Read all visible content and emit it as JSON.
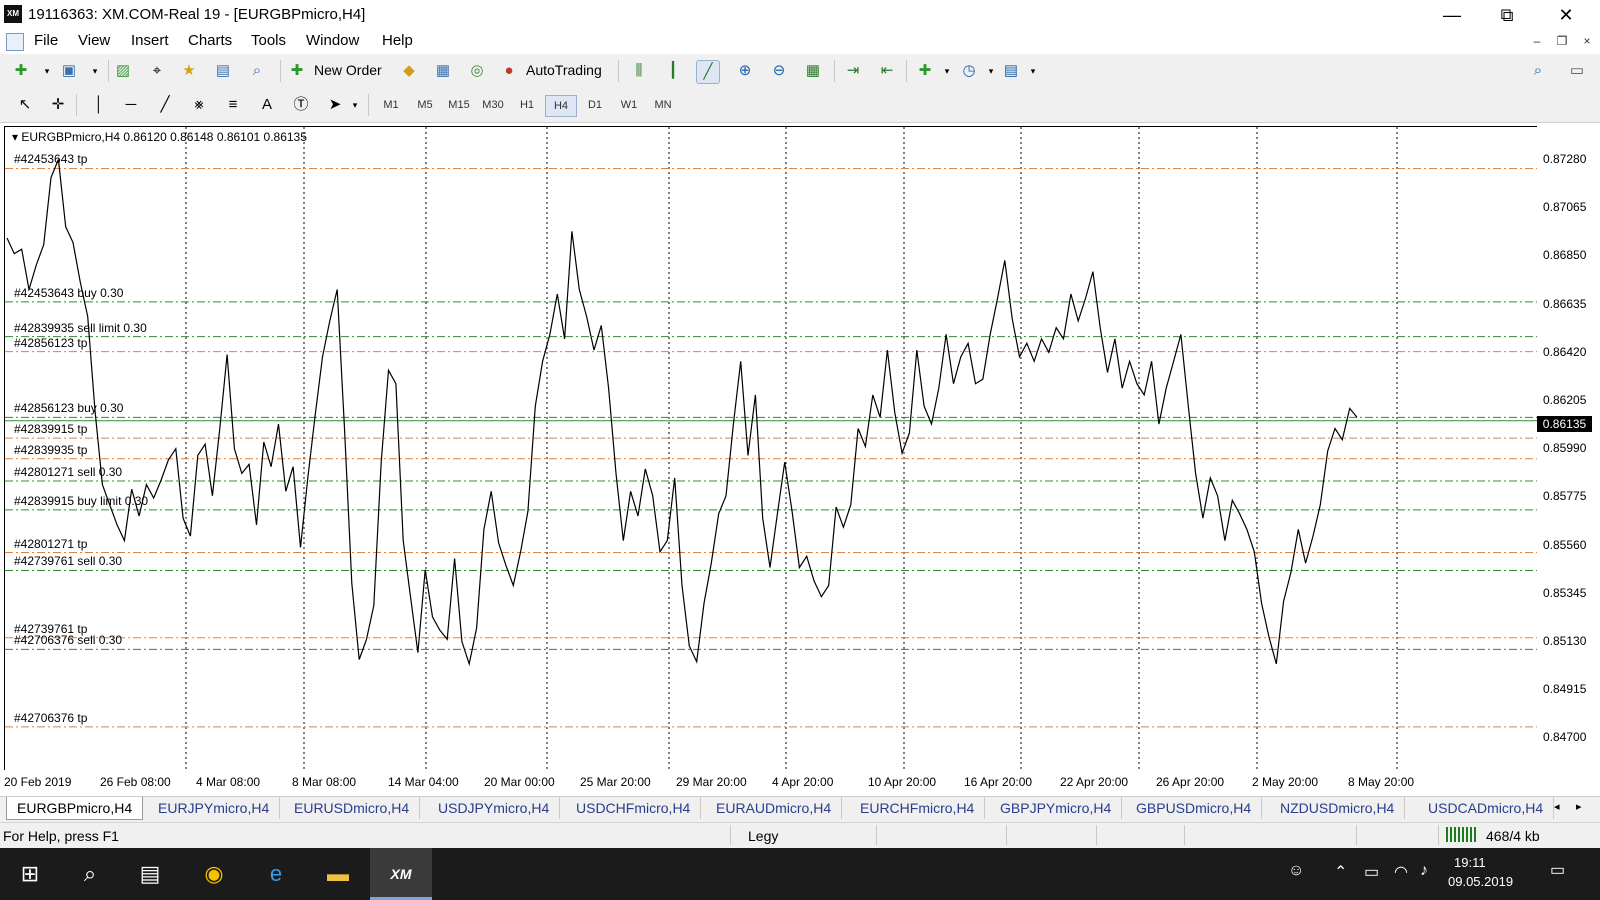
{
  "window": {
    "title": "19116363: XM.COM-Real 19 - [EURGBPmicro,H4]",
    "logo_text": "XM",
    "minimize_symbol": "—",
    "maximize_symbol": "⧉",
    "close_symbol": "✕"
  },
  "menu": {
    "items": [
      "File",
      "View",
      "Insert",
      "Charts",
      "Tools",
      "Window",
      "Help"
    ],
    "mdi_minimize": "–",
    "mdi_restore": "❐",
    "mdi_close": "×"
  },
  "toolbar": {
    "new_order_label": "New Order",
    "autotrading_label": "AutoTrading",
    "timeframes": [
      "M1",
      "M5",
      "M15",
      "M30",
      "H1",
      "H4",
      "D1",
      "W1",
      "MN"
    ],
    "active_timeframe": "H4",
    "icons": [
      "new-chart-icon",
      "profiles-icon",
      "market-watch-icon",
      "navigator-icon",
      "data-window-icon",
      "terminal-icon",
      "strategy-tester-icon",
      "meta-editor-icon",
      "new-order-icon",
      "autotrading-icon",
      "bar-chart-icon",
      "candlesticks-icon",
      "line-chart-icon",
      "zoom-in-icon",
      "zoom-out-icon",
      "tile-windows-icon",
      "auto-scroll-icon",
      "chart-shift-icon",
      "indicators-icon",
      "periods-icon",
      "templates-icon",
      "search-icon",
      "chat-icon",
      "cursor-icon",
      "crosshair-icon",
      "vertical-line-icon",
      "horizontal-line-icon",
      "trendline-icon",
      "equidistant-channel-icon",
      "fibonacci-icon",
      "text-icon",
      "text-label-icon",
      "arrows-icon"
    ]
  },
  "chart": {
    "symbol_info": "EURGBPmicro,H4  0.86120 0.86148 0.86101 0.86135",
    "current_price": "0.86135",
    "price_labels": [
      "0.87280",
      "0.87065",
      "0.86850",
      "0.86635",
      "0.86420",
      "0.86205",
      "0.85990",
      "0.85775",
      "0.85560",
      "0.85345",
      "0.85130",
      "0.84915",
      "0.84700"
    ],
    "time_labels": [
      "20 Feb 2019",
      "26 Feb 08:00",
      "4 Mar 08:00",
      "8 Mar 08:00",
      "14 Mar 04:00",
      "20 Mar 00:00",
      "25 Mar 20:00",
      "29 Mar 20:00",
      "4 Apr 20:00",
      "10 Apr 20:00",
      "16 Apr 20:00",
      "22 Apr 20:00",
      "26 Apr 20:00",
      "2 May 20:00",
      "8 May 20:00"
    ],
    "order_lines": [
      {
        "label": "#42453643 tp",
        "price": 0.8726,
        "color": "#e0803a"
      },
      {
        "label": "#42453643 buy 0.30",
        "price": 0.86665,
        "color": "#2e8b2e"
      },
      {
        "label": "#42839935 sell limit 0.30",
        "price": 0.8651,
        "color": "#2e8b2e"
      },
      {
        "label": "#42856123 tp",
        "price": 0.86443,
        "color": "#e0803a"
      },
      {
        "label": "#42856123 buy 0.30",
        "price": 0.8615,
        "color": "#2e8b2e"
      },
      {
        "label": "#42839915 tp",
        "price": 0.86057,
        "color": "#e0803a"
      },
      {
        "label": "#42839935 tp",
        "price": 0.85965,
        "color": "#e0803a"
      },
      {
        "label": "#42801271 sell 0.30",
        "price": 0.85866,
        "color": "#2e8b2e"
      },
      {
        "label": "#42839915 buy limit 0.30",
        "price": 0.85737,
        "color": "#2e8b2e"
      },
      {
        "label": "#42801271 tp",
        "price": 0.85547,
        "color": "#e0803a"
      },
      {
        "label": "#42739761 sell 0.30",
        "price": 0.85467,
        "color": "#2e8b2e"
      },
      {
        "label": "#42739761 tp",
        "price": 0.85167,
        "color": "#e0803a"
      },
      {
        "label": "#42706376 sell 0.30",
        "price": 0.85115,
        "color": "#2e8b2e"
      },
      {
        "label": "#42706376 tp",
        "price": 0.84769,
        "color": "#e0803a"
      }
    ]
  },
  "chart_data": {
    "type": "line",
    "title": "EURGBPmicro,H4  0.86120 0.86148 0.86101 0.86135",
    "xlabel": "",
    "ylabel": "",
    "ylim": [
      0.8465,
      0.8742
    ],
    "grid": true,
    "x_tick_labels": [
      "20 Feb 2019",
      "26 Feb 08:00",
      "4 Mar 08:00",
      "8 Mar 08:00",
      "14 Mar 04:00",
      "20 Mar 00:00",
      "25 Mar 20:00",
      "29 Mar 20:00",
      "4 Apr 20:00",
      "10 Apr 20:00",
      "16 Apr 20:00",
      "22 Apr 20:00",
      "26 Apr 20:00",
      "2 May 20:00",
      "8 May 20:00"
    ],
    "y_tick_labels": [
      "0.87280",
      "0.87065",
      "0.86850",
      "0.86635",
      "0.86420",
      "0.86205",
      "0.85990",
      "0.85775",
      "0.85560",
      "0.85345",
      "0.85130",
      "0.84915",
      "0.84700"
    ],
    "series": [
      {
        "name": "EURGBPmicro,H4",
        "values": [
          0.8695,
          0.8688,
          0.869,
          0.8672,
          0.8683,
          0.8692,
          0.8722,
          0.873,
          0.87,
          0.8693,
          0.8675,
          0.866,
          0.8618,
          0.8585,
          0.8576,
          0.8567,
          0.856,
          0.8583,
          0.8571,
          0.8585,
          0.8579,
          0.8587,
          0.8596,
          0.8601,
          0.857,
          0.8562,
          0.8598,
          0.8603,
          0.858,
          0.861,
          0.8643,
          0.8601,
          0.859,
          0.8594,
          0.8567,
          0.8604,
          0.8593,
          0.8612,
          0.8582,
          0.8593,
          0.8557,
          0.8588,
          0.8616,
          0.8642,
          0.8658,
          0.8672,
          0.861,
          0.8541,
          0.8507,
          0.8516,
          0.8531,
          0.8595,
          0.8636,
          0.863,
          0.856,
          0.8535,
          0.851,
          0.8547,
          0.8526,
          0.852,
          0.8516,
          0.8552,
          0.8515,
          0.8505,
          0.8521,
          0.8565,
          0.8582,
          0.8559,
          0.8549,
          0.854,
          0.8555,
          0.8573,
          0.862,
          0.864,
          0.8652,
          0.867,
          0.865,
          0.8698,
          0.8672,
          0.866,
          0.8645,
          0.8656,
          0.8628,
          0.859,
          0.856,
          0.8582,
          0.8571,
          0.8592,
          0.858,
          0.8555,
          0.856,
          0.8588,
          0.854,
          0.8513,
          0.8506,
          0.8532,
          0.855,
          0.8572,
          0.858,
          0.8612,
          0.864,
          0.8598,
          0.8625,
          0.857,
          0.8548,
          0.8572,
          0.8595,
          0.8573,
          0.8548,
          0.8553,
          0.8542,
          0.8535,
          0.854,
          0.8575,
          0.8566,
          0.8576,
          0.861,
          0.8602,
          0.8625,
          0.8615,
          0.8645,
          0.8617,
          0.8599,
          0.8608,
          0.8645,
          0.862,
          0.8612,
          0.8628,
          0.8652,
          0.863,
          0.8642,
          0.8648,
          0.863,
          0.8632,
          0.8652,
          0.8668,
          0.8685,
          0.8659,
          0.8642,
          0.8648,
          0.864,
          0.865,
          0.8644,
          0.8655,
          0.865,
          0.867,
          0.8658,
          0.8668,
          0.868,
          0.8655,
          0.8635,
          0.865,
          0.8628,
          0.864,
          0.863,
          0.8625,
          0.864,
          0.8612,
          0.8628,
          0.864,
          0.8652,
          0.862,
          0.859,
          0.857,
          0.8588,
          0.858,
          0.856,
          0.8578,
          0.8572,
          0.8565,
          0.8555,
          0.8532,
          0.8517,
          0.8505,
          0.8533,
          0.8546,
          0.8565,
          0.855,
          0.8562,
          0.8576,
          0.86,
          0.861,
          0.8605,
          0.8619,
          0.8615
        ]
      }
    ]
  },
  "tabs": [
    "EURGBPmicro,H4",
    "EURJPYmicro,H4",
    "EURUSDmicro,H4",
    "USDJPYmicro,H4",
    "USDCHFmicro,H4",
    "EURAUDmicro,H4",
    "EURCHFmicro,H4",
    "GBPJPYmicro,H4",
    "GBPUSDmicro,H4",
    "NZDUSDmicro,H4",
    "USDCADmicro,H4"
  ],
  "tab_scroll_left": "◂",
  "tab_scroll_right": "▸",
  "status": {
    "help_text": "For Help, press F1",
    "profile": "Legy",
    "traffic": "468/4 kb"
  },
  "taskbar": {
    "clock_time": "19:11",
    "clock_date": "09.05.2019",
    "xm_label": "XM"
  }
}
